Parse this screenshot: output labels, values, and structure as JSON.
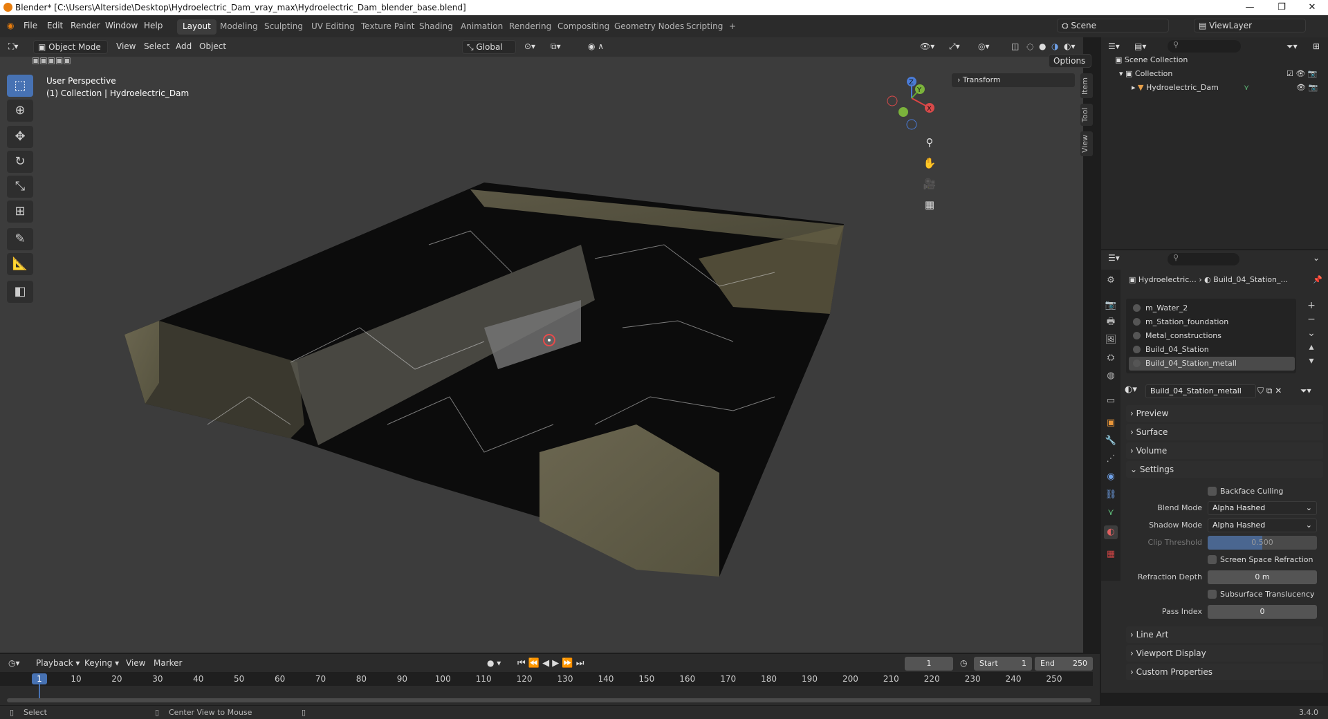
{
  "titlebar": {
    "title": "Blender* [C:\\Users\\Alterside\\Desktop\\Hydroelectric_Dam_vray_max\\Hydroelectric_Dam_blender_base.blend]",
    "minimize": "—",
    "maximize": "❐",
    "close": "✕"
  },
  "menu": [
    "File",
    "Edit",
    "Render",
    "Window",
    "Help"
  ],
  "workspaces": [
    "Layout",
    "Modeling",
    "Sculpting",
    "UV Editing",
    "Texture Paint",
    "Shading",
    "Animation",
    "Rendering",
    "Compositing",
    "Geometry Nodes",
    "Scripting",
    "+"
  ],
  "scene": {
    "scene_label": "Scene",
    "viewlayer_label": "ViewLayer"
  },
  "viewport": {
    "mode": "Object Mode",
    "menus": [
      "View",
      "Select",
      "Add",
      "Object"
    ],
    "orientation": "Global",
    "options": "Options",
    "info_line1": "User Perspective",
    "info_line2": "(1) Collection | Hydroelectric_Dam",
    "n_panel_transform": "Transform",
    "side_tabs": [
      "Item",
      "Tool",
      "View"
    ],
    "gizmo_axes": [
      "Z",
      "Y",
      "X"
    ]
  },
  "outliner": {
    "scene_collection": "Scene Collection",
    "collection": "Collection",
    "object": "Hydroelectric_Dam"
  },
  "properties": {
    "breadcrumb_object": "Hydroelectric...",
    "breadcrumb_material": "Build_04_Station_...",
    "material_slots": [
      "m_Water_2",
      "m_Station_foundation",
      "Metal_constructions",
      "Build_04_Station",
      "Build_04_Station_metall"
    ],
    "selected_slot": "Build_04_Station_metall",
    "material_name": "Build_04_Station_metall",
    "sections": {
      "preview": "Preview",
      "surface": "Surface",
      "volume": "Volume",
      "settings": "Settings",
      "line_art": "Line Art",
      "viewport_display": "Viewport Display",
      "custom_properties": "Custom Properties"
    },
    "settings": {
      "backface_culling": "Backface Culling",
      "blend_mode_label": "Blend Mode",
      "blend_mode": "Alpha Hashed",
      "shadow_mode_label": "Shadow Mode",
      "shadow_mode": "Alpha Hashed",
      "clip_threshold_label": "Clip Threshold",
      "clip_threshold": "0.500",
      "screen_space_refraction": "Screen Space Refraction",
      "refraction_depth_label": "Refraction Depth",
      "refraction_depth": "0 m",
      "subsurface_translucency": "Subsurface Translucency",
      "pass_index_label": "Pass Index",
      "pass_index": "0"
    }
  },
  "timeline": {
    "menus": [
      "Playback",
      "Keying",
      "View",
      "Marker"
    ],
    "current_frame": "1",
    "start_label": "Start",
    "start": "1",
    "end_label": "End",
    "end": "250",
    "ticks": [
      "1",
      "10",
      "20",
      "30",
      "40",
      "50",
      "60",
      "70",
      "80",
      "90",
      "100",
      "110",
      "120",
      "130",
      "140",
      "150",
      "160",
      "170",
      "180",
      "190",
      "200",
      "210",
      "220",
      "230",
      "240",
      "250"
    ]
  },
  "statusbar": {
    "left": "Select",
    "middle": "Center View to Mouse",
    "version": "3.4.0"
  }
}
